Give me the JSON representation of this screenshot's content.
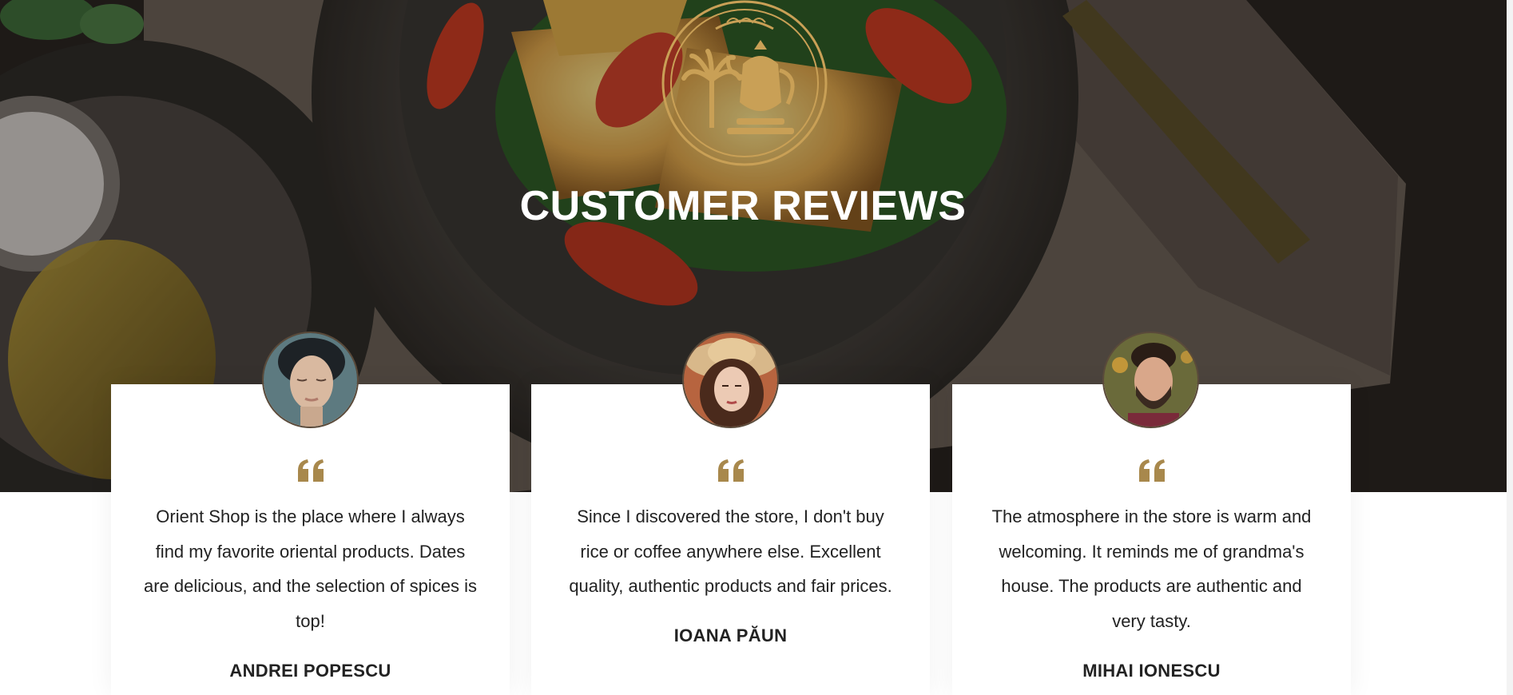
{
  "section": {
    "title": "CUSTOMER REVIEWS"
  },
  "colors": {
    "accent": "#A8884C",
    "text": "#222222",
    "card_bg": "#FFFFFF"
  },
  "reviews": [
    {
      "text": "Orient Shop is the place where I always find my favorite oriental products. Dates are delicious, and the selection of spices is top!",
      "name": "ANDREI POPESCU",
      "avatar_icon": "avatar-man-asian"
    },
    {
      "text": "Since I discovered the store, I don't buy rice or coffee anywhere else. Excellent quality, authentic products and fair prices.",
      "name": "IOANA PĂUN",
      "avatar_icon": "avatar-woman-hat"
    },
    {
      "text": "The atmosphere in the store is warm and welcoming. It reminds me of grandma's house. The products are authentic and very tasty.",
      "name": "MIHAI IONESCU",
      "avatar_icon": "avatar-man-beard"
    }
  ]
}
